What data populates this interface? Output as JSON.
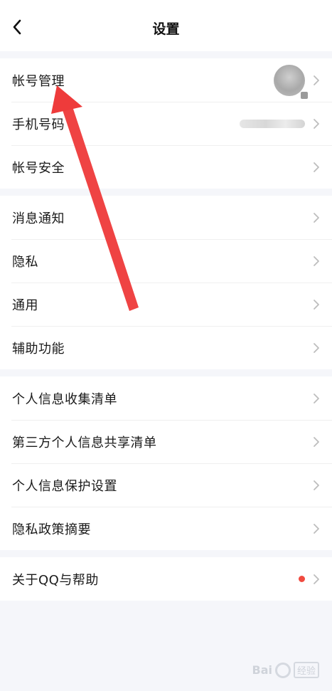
{
  "header": {
    "title": "设置",
    "back_icon": "chevron-left-icon"
  },
  "groups": [
    {
      "rows": [
        {
          "label": "帐号管理",
          "accessory": "avatar"
        },
        {
          "label": "手机号码",
          "accessory": "blurred-phone"
        },
        {
          "label": "帐号安全",
          "accessory": "chevron"
        }
      ]
    },
    {
      "rows": [
        {
          "label": "消息通知",
          "accessory": "chevron"
        },
        {
          "label": "隐私",
          "accessory": "chevron"
        },
        {
          "label": "通用",
          "accessory": "chevron"
        },
        {
          "label": "辅助功能",
          "accessory": "chevron"
        }
      ]
    },
    {
      "rows": [
        {
          "label": "个人信息收集清单",
          "accessory": "chevron"
        },
        {
          "label": "第三方个人信息共享清单",
          "accessory": "chevron"
        },
        {
          "label": "个人信息保护设置",
          "accessory": "chevron"
        },
        {
          "label": "隐私政策摘要",
          "accessory": "chevron"
        }
      ]
    },
    {
      "rows": [
        {
          "label": "关于QQ与帮助",
          "accessory": "red-dot-chevron"
        }
      ]
    }
  ],
  "colors": {
    "background": "#f5f6fa",
    "card": "#ffffff",
    "chevron": "#bdbdbd",
    "annotation_arrow": "#ee3b3b",
    "badge": "#f04a3f"
  },
  "watermark": {
    "brand": "Bai",
    "brand_suffix": "经验"
  }
}
